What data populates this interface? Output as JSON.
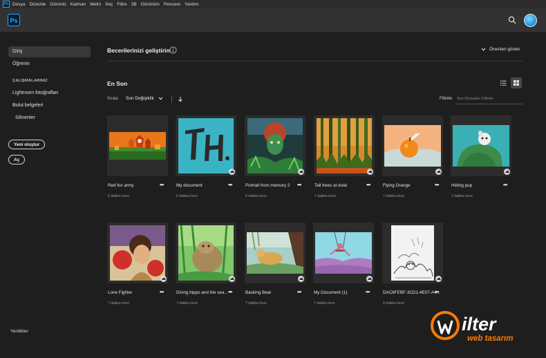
{
  "menubar": {
    "app_icon": "Ps",
    "items": [
      "Dosya",
      "Düzenle",
      "Görüntü",
      "Katman",
      "Metin",
      "Seç",
      "Filtre",
      "3B",
      "Görünüm",
      "Pencere",
      "Yardım"
    ]
  },
  "topbar": {
    "logo_text": "Ps",
    "search_icon": "search-icon",
    "avatar_icon": "user-avatar"
  },
  "sidebar": {
    "home": "Giriş",
    "learn": "Öğrenin",
    "section_heading": "ÇALIŞMALARINIZ",
    "lightroom": "Lightroom fotoğrafları",
    "cloud_docs": "Bulut belgeleri",
    "deleted": "Silinenler",
    "new_button": "Yeni oluştur",
    "open_button": "Aç",
    "whats_new": "Yenilikler"
  },
  "banner": {
    "title": "Becerilerinizi geliştirin",
    "show_recommendations": "Önerileri göster"
  },
  "recent": {
    "title": "En Son",
    "sort_label": "Sırala",
    "sort_value": "Son Değişiklik",
    "filter_label": "Filtrele",
    "filter_placeholder": "Son Dosyaları Filtrele"
  },
  "documents": [
    {
      "name": "Red fox army",
      "time": "6 dakika önce",
      "cloud": false
    },
    {
      "name": "My document",
      "time": "6 dakika önce",
      "cloud": true
    },
    {
      "name": "Portrait from memory 2",
      "time": "6 dakika önce",
      "cloud": true
    },
    {
      "name": "Tall trees at dusk",
      "time": "7 dakika önce",
      "cloud": true
    },
    {
      "name": "Flying Orange",
      "time": "7 dakika önce",
      "cloud": true
    },
    {
      "name": "Hiding pup",
      "time": "7 dakika önce",
      "cloud": true
    },
    {
      "name": "Lone Fighter",
      "time": "7 dakika önce",
      "cloud": true
    },
    {
      "name": "Diving hippo and the sea...",
      "time": "7 dakika önce",
      "cloud": true
    },
    {
      "name": "Basking Bear",
      "time": "7 dakika önce",
      "cloud": true
    },
    {
      "name": "My Document (1)",
      "time": "7 dakika önce",
      "cloud": true
    },
    {
      "name": "DAC6FEBF-3CD1-4E07-A4...",
      "time": "9 dakika önce",
      "cloud": true
    }
  ],
  "more_glyph": "•••",
  "watermark": {
    "brand": "ilter",
    "sub": "web tasarım"
  },
  "colors": {
    "accent": "#31a8ff",
    "watermark_orange": "#ff7a00"
  }
}
